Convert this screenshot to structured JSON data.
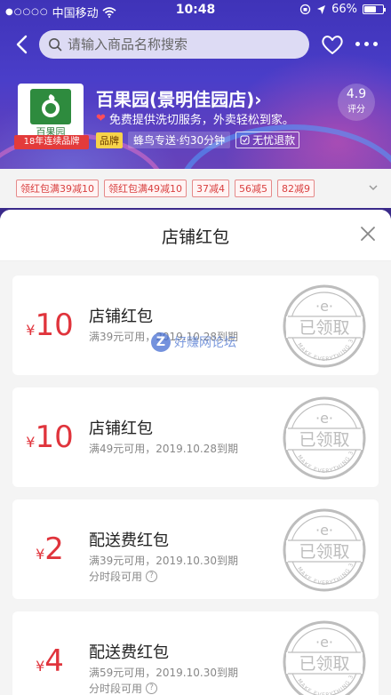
{
  "status_bar": {
    "carrier": "中国移动",
    "time": "10:48",
    "battery": "66%",
    "battery_level": 0.66
  },
  "nav": {
    "search_placeholder": "请输入商品名称搜索"
  },
  "store": {
    "logo_text": "百果园",
    "years_badge": "18年连续品牌",
    "name": "百果园(景明佳园店)",
    "description": "免费提供洗切服务，外卖轻松到家。",
    "tag_brand": "品牌",
    "delivery": "蜂鸟专送·约30分钟",
    "refund": "无忧退款",
    "rating_score": "4.9",
    "rating_label": "评分"
  },
  "coupon_strip": {
    "chips": [
      "领红包满39减10",
      "领红包满49减10",
      "37减4",
      "56减5",
      "82减9"
    ]
  },
  "sheet": {
    "title": "店铺红包",
    "coupons": [
      {
        "currency": "¥",
        "amount": "10",
        "title": "店铺红包",
        "desc": "满39元可用，2019.10.28到期",
        "note": "",
        "status": "已领取"
      },
      {
        "currency": "¥",
        "amount": "10",
        "title": "店铺红包",
        "desc": "满49元可用，2019.10.28到期",
        "note": "",
        "status": "已领取"
      },
      {
        "currency": "¥",
        "amount": "2",
        "title": "配送费红包",
        "desc": "满39元可用，2019.10.30到期",
        "note": "分时段可用",
        "status": "已领取"
      },
      {
        "currency": "¥",
        "amount": "4",
        "title": "配送费红包",
        "desc": "满59元可用，2019.10.30到期",
        "note": "分时段可用",
        "status": "已领取"
      }
    ],
    "stamp_ring_text": "MAKE EVERYTHING 30"
  },
  "watermark": {
    "icon": "Z",
    "text": "好赚网论坛"
  },
  "colors": {
    "accent_red": "#e0343c",
    "header_purple": "#4a3ec9",
    "stamp_gray": "#bdbdbd"
  }
}
